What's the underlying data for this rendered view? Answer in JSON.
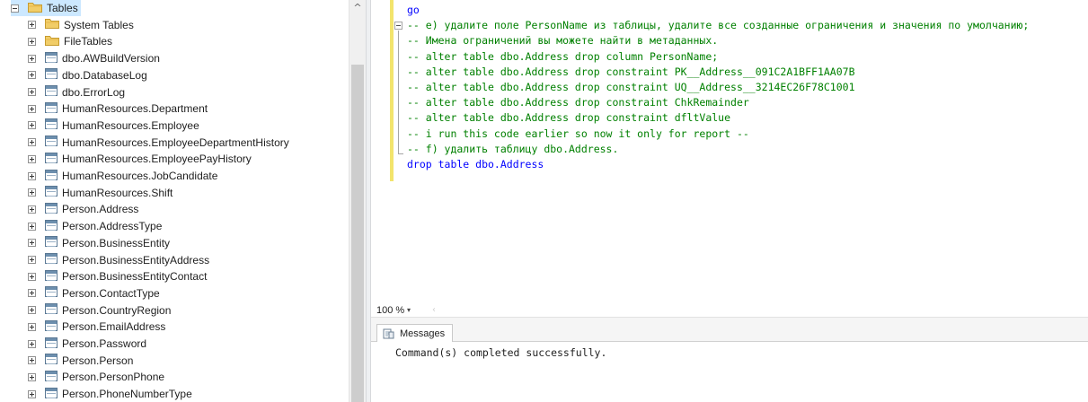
{
  "object_explorer": {
    "root": {
      "label": "Tables",
      "icon": "folder-icon",
      "expanded": true
    },
    "items": [
      {
        "label": "System Tables",
        "icon": "folder-icon"
      },
      {
        "label": "FileTables",
        "icon": "folder-icon"
      },
      {
        "label": "dbo.AWBuildVersion",
        "icon": "table-icon"
      },
      {
        "label": "dbo.DatabaseLog",
        "icon": "table-icon"
      },
      {
        "label": "dbo.ErrorLog",
        "icon": "table-icon"
      },
      {
        "label": "HumanResources.Department",
        "icon": "table-icon"
      },
      {
        "label": "HumanResources.Employee",
        "icon": "table-icon"
      },
      {
        "label": "HumanResources.EmployeeDepartmentHistory",
        "icon": "table-icon"
      },
      {
        "label": "HumanResources.EmployeePayHistory",
        "icon": "table-icon"
      },
      {
        "label": "HumanResources.JobCandidate",
        "icon": "table-icon"
      },
      {
        "label": "HumanResources.Shift",
        "icon": "table-icon"
      },
      {
        "label": "Person.Address",
        "icon": "table-icon"
      },
      {
        "label": "Person.AddressType",
        "icon": "table-icon"
      },
      {
        "label": "Person.BusinessEntity",
        "icon": "table-icon"
      },
      {
        "label": "Person.BusinessEntityAddress",
        "icon": "table-icon"
      },
      {
        "label": "Person.BusinessEntityContact",
        "icon": "table-icon"
      },
      {
        "label": "Person.ContactType",
        "icon": "table-icon"
      },
      {
        "label": "Person.CountryRegion",
        "icon": "table-icon"
      },
      {
        "label": "Person.EmailAddress",
        "icon": "table-icon"
      },
      {
        "label": "Person.Password",
        "icon": "table-icon"
      },
      {
        "label": "Person.Person",
        "icon": "table-icon"
      },
      {
        "label": "Person.PersonPhone",
        "icon": "table-icon"
      },
      {
        "label": "Person.PhoneNumberType",
        "icon": "table-icon"
      }
    ],
    "scroll_up_glyph": "^"
  },
  "editor": {
    "lines": [
      {
        "text": "go",
        "kind": "keyword"
      },
      {
        "text": "-- e) удалите поле PersonName из таблицы, удалите все созданные ограничения и значения по умолчанию;",
        "kind": "comment"
      },
      {
        "text": "-- Имена ограничений вы можете найти в метаданных.",
        "kind": "comment"
      },
      {
        "text": "-- alter table dbo.Address drop column PersonName;",
        "kind": "comment"
      },
      {
        "text": "-- alter table dbo.Address drop constraint PK__Address__091C2A1BFF1AA07B",
        "kind": "comment"
      },
      {
        "text": "-- alter table dbo.Address drop constraint UQ__Address__3214EC26F78C1001",
        "kind": "comment"
      },
      {
        "text": "-- alter table dbo.Address drop constraint ChkRemainder",
        "kind": "comment"
      },
      {
        "text": "-- alter table dbo.Address drop constraint dfltValue",
        "kind": "comment"
      },
      {
        "text": "-- i run this code earlier so now it only for report --",
        "kind": "comment"
      },
      {
        "text": "-- f) удалить таблицу dbo.Address.",
        "kind": "comment"
      },
      {
        "text": "drop table dbo.Address",
        "kind": "keyword"
      }
    ],
    "zoom": "100 %",
    "zoom_arrow": "▾",
    "hscroll_left_glyph": "‹"
  },
  "results": {
    "tab_label": "Messages",
    "message": "Command(s) completed successfully."
  },
  "colors": {
    "keyword": "#0000ff",
    "comment": "#008000",
    "selection": "#cce8ff",
    "change_bar": "#f3e46c"
  }
}
